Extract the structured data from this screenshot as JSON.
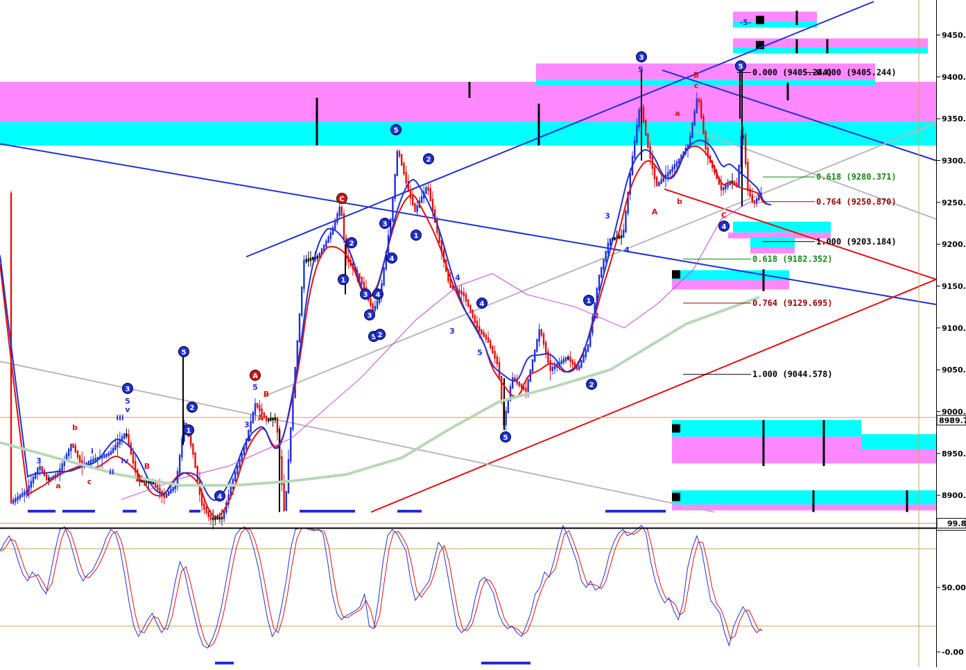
{
  "chart_data": [
    {
      "type": "candlestick",
      "panel": "price",
      "ylim": [
        8880,
        9490
      ],
      "y_ticks": [
        "9450.00",
        "9400.00",
        "9350.00",
        "9300.00",
        "9250.00",
        "9200.00",
        "9150.00",
        "9100.00",
        "9050.00",
        "9000.00",
        "8950.00",
        "8900.00"
      ],
      "current_marker": {
        "label": "8989.7",
        "value": 8989.7
      },
      "colors": {
        "bull": "#1e2fd8",
        "bear": "#e01010",
        "neutral": "#000000",
        "ma_fast": "#e01010",
        "ma_mid": "#1e2fd8",
        "ma_slow": "#cc44cc",
        "ma_long": "#b8d8b8",
        "zone_magenta": "#ff88ff",
        "zone_cyan": "#00ffff"
      },
      "fib_levels": [
        {
          "label": "0.000 (9405.244)",
          "value": 9405.244,
          "color": "#000000"
        },
        {
          "label": "0.000 (9405.244)",
          "value": 9405.244,
          "color": "#000000"
        },
        {
          "label": "0.618 (9280.371)",
          "value": 9280.371,
          "color": "#118811"
        },
        {
          "label": "0.764 (9250.870)",
          "value": 9250.87,
          "color": "#990000"
        },
        {
          "label": "1.000 (9203.184)",
          "value": 9203.184,
          "color": "#000000"
        },
        {
          "label": "0.618 (9182.352)",
          "value": 9182.352,
          "color": "#118811"
        },
        {
          "label": "0.764 (9129.695)",
          "value": 9129.695,
          "color": "#990000"
        },
        {
          "label": "1.000 (9044.578)",
          "value": 9044.578,
          "color": "#000000"
        }
      ],
      "wave_labels": [
        {
          "text": "3",
          "style": "circle-blue",
          "value": 9063
        },
        {
          "text": "5",
          "style": "circle-blue",
          "value": 9322
        },
        {
          "text": "C",
          "style": "circle-red",
          "value": 9255
        },
        {
          "text": "A",
          "style": "circle-red",
          "value": 9043
        },
        {
          "text": "5",
          "style": "circle-blue",
          "value": 9345
        },
        {
          "text": "2",
          "style": "circle-blue",
          "value": 9295
        },
        {
          "text": "1",
          "style": "circle-blue",
          "value": 9213
        },
        {
          "text": "3",
          "style": "circle-blue",
          "value": 9233
        },
        {
          "text": "4",
          "style": "circle-blue",
          "value": 9197
        },
        {
          "text": "2",
          "style": "circle-blue",
          "value": 9203
        },
        {
          "text": "1",
          "style": "circle-blue",
          "value": 9158
        },
        {
          "text": "4",
          "style": "circle-blue",
          "value": 9146
        },
        {
          "text": "3",
          "style": "circle-blue",
          "value": 9117
        },
        {
          "text": "5",
          "style": "circle-blue",
          "value": 9095
        },
        {
          "text": "2",
          "style": "circle-blue",
          "value": 9098
        },
        {
          "text": "1",
          "style": "circle-blue",
          "value": 9155
        },
        {
          "text": "3",
          "style": "circle-blue",
          "value": 9050
        },
        {
          "text": "4",
          "style": "circle-blue",
          "value": 9114
        },
        {
          "text": "5",
          "style": "circle-blue",
          "value": 8975
        },
        {
          "text": "1",
          "style": "circle-blue",
          "value": 9114
        },
        {
          "text": "2",
          "style": "circle-blue",
          "value": 9034
        },
        {
          "text": "3",
          "style": "circle-blue",
          "value": 9418
        },
        {
          "text": "5",
          "style": "circle-blue",
          "value": 9403
        },
        {
          "text": "4",
          "style": "circle-blue",
          "value": 9224
        },
        {
          "text": "2",
          "style": "circle-blue",
          "value": 9008
        },
        {
          "text": "1",
          "style": "circle-blue",
          "value": 9004
        },
        {
          "text": "4",
          "style": "circle-blue",
          "value": 8895
        },
        {
          "text": "5",
          "style": "text-blue",
          "value": 9028
        },
        {
          "text": "v",
          "style": "text-blue",
          "value": 9010
        },
        {
          "text": "iii",
          "style": "text-blue",
          "value": 8997
        },
        {
          "text": "i",
          "style": "text-blue",
          "value": 8958
        },
        {
          "text": "ii",
          "style": "text-blue",
          "value": 8932
        },
        {
          "text": "iv",
          "style": "text-blue",
          "value": 8945
        },
        {
          "text": "3",
          "style": "text-blue",
          "value": 8948
        },
        {
          "text": "b",
          "style": "text-red",
          "value": 8978
        },
        {
          "text": "c",
          "style": "text-red",
          "value": 8899
        },
        {
          "text": "a",
          "style": "text-red",
          "value": 8891
        },
        {
          "text": "B",
          "style": "text-red",
          "value": 8940
        },
        {
          "text": "A",
          "style": "text-red",
          "value": 8902
        },
        {
          "text": "5",
          "style": "text-blue",
          "value": 9030
        },
        {
          "text": "B",
          "style": "text-red",
          "value": 9021
        },
        {
          "text": "A",
          "style": "text-red",
          "value": 8993
        },
        {
          "text": "3",
          "style": "text-blue",
          "value": 8983
        },
        {
          "text": "4",
          "style": "text-blue",
          "value": 8961
        },
        {
          "text": "4",
          "style": "text-blue",
          "value": 9154
        },
        {
          "text": "3",
          "style": "text-blue",
          "value": 9088
        },
        {
          "text": "5",
          "style": "text-blue",
          "value": 9059
        },
        {
          "text": "3",
          "style": "text-blue",
          "value": 9236
        },
        {
          "text": "4",
          "style": "text-blue",
          "value": 9197
        },
        {
          "text": "2",
          "style": "text-blue",
          "value": 9100
        },
        {
          "text": "5",
          "style": "text-blue",
          "value": 9402
        },
        {
          "text": "A",
          "style": "text-red",
          "value": 9238
        },
        {
          "text": "a",
          "style": "text-red",
          "value": 9349
        },
        {
          "text": "B",
          "style": "text-red",
          "value": 9395
        },
        {
          "text": "c",
          "style": "text-red",
          "value": 9384
        },
        {
          "text": "b",
          "style": "text-red",
          "value": 9252
        },
        {
          "text": "C",
          "style": "text-red",
          "value": 9235
        },
        {
          "text": "-5-",
          "style": "text-blue",
          "value": 9467
        }
      ]
    },
    {
      "type": "line",
      "panel": "stochastic",
      "ylim": [
        0,
        99.8
      ],
      "y_ticks": [
        "50.00",
        "-0.00"
      ],
      "current_marker": {
        "label": "99.8",
        "value": 99.8
      },
      "reference_levels": [
        20,
        80,
        99.8
      ],
      "series": [
        {
          "color": "#1e2fd8",
          "values": [
            78,
            85,
            90,
            82,
            70,
            60,
            55,
            62,
            58,
            50,
            45,
            62,
            80,
            95,
            97,
            88,
            75,
            62,
            55,
            60,
            63,
            70,
            78,
            88,
            95,
            92,
            80,
            60,
            38,
            20,
            12,
            18,
            25,
            30,
            22,
            15,
            20,
            35,
            55,
            70,
            62,
            45,
            30,
            15,
            5,
            3,
            10,
            20,
            35,
            55,
            75,
            90,
            95,
            97,
            92,
            80,
            65,
            45,
            25,
            12,
            18,
            35,
            55,
            80,
            95,
            96,
            96,
            95,
            94,
            95,
            92,
            70,
            45,
            30,
            25,
            28,
            30,
            32,
            35,
            45,
            20,
            18,
            40,
            70,
            90,
            95,
            92,
            85,
            78,
            55,
            40,
            45,
            50,
            55,
            70,
            85,
            80,
            60,
            40,
            20,
            15,
            18,
            25,
            42,
            55,
            58,
            52,
            45,
            30,
            22,
            18,
            20,
            15,
            12,
            20,
            30,
            45,
            50,
            62,
            58,
            70,
            85,
            98,
            90,
            80,
            70,
            55,
            50,
            55,
            48,
            50,
            60,
            75,
            85,
            92,
            95,
            90,
            92,
            95,
            98,
            92,
            70,
            55,
            45,
            38,
            42,
            32,
            25,
            38,
            65,
            80,
            90,
            80,
            60,
            40,
            35,
            30,
            15,
            5,
            20,
            28,
            35,
            30,
            20,
            15,
            18
          ]
        }
      ]
    }
  ],
  "page": {
    "bg": "#ffffff"
  }
}
